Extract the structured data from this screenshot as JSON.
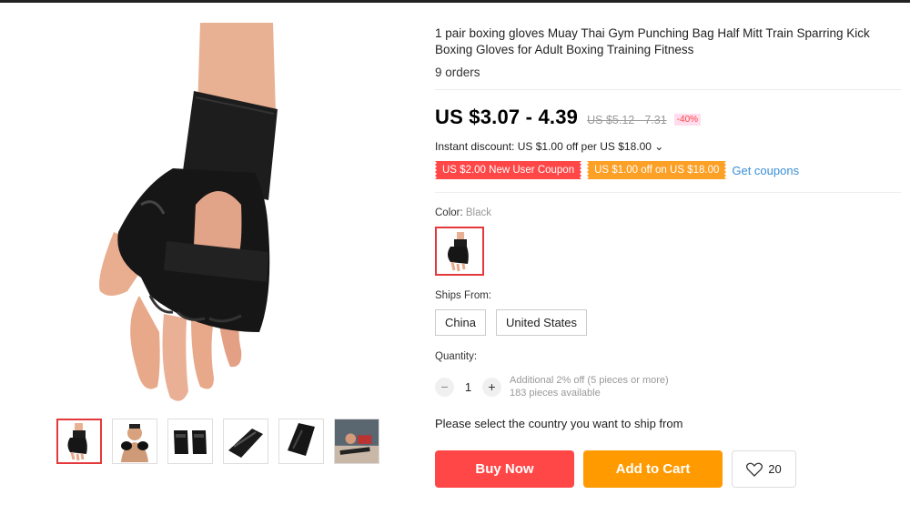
{
  "product": {
    "title": "1 pair boxing gloves Muay Thai Gym Punching Bag Half Mitt Train Sparring Kick Boxing Gloves for Adult Boxing Training Fitness",
    "orders": "9 orders",
    "price": "US $3.07 - 4.39",
    "old_price": "US $5.12 - 7.31",
    "discount": "-40%",
    "instant_discount": "Instant discount: US $1.00 off per US $18.00 ⌄"
  },
  "coupons": {
    "new_user": "US $2.00 New User Coupon",
    "store": "US $1.00 off on US $18.00",
    "get_link": "Get coupons"
  },
  "color": {
    "label": "Color: ",
    "value": "Black"
  },
  "ships_from": {
    "label": "Ships From:",
    "options": [
      "China",
      "United States"
    ]
  },
  "quantity": {
    "label": "Quantity:",
    "value": "1",
    "minus": "−",
    "plus": "+",
    "note_line1": "Additional 2% off (5 pieces or more)",
    "note_line2": "183 pieces available"
  },
  "ship_message": "Please select the country you want to ship from",
  "actions": {
    "buy": "Buy Now",
    "cart": "Add to Cart",
    "wish_count": "20"
  },
  "colors": {
    "buy": "#ff4747",
    "cart": "#ff9a00",
    "link": "#3a8fd8",
    "selected_border": "#e4393c"
  }
}
